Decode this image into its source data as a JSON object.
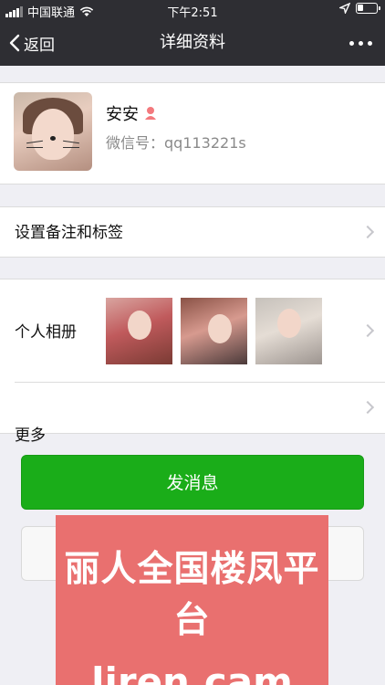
{
  "status_bar": {
    "carrier": "中国联通",
    "time": "下午2:51"
  },
  "nav": {
    "back_label": "返回",
    "title": "详细资料"
  },
  "profile": {
    "name": "安安",
    "wechat_id": "微信号：qq113221s",
    "gender_icon": "female-icon",
    "gender_color": "#f3797d"
  },
  "rows": {
    "remark_label": "设置备注和标签",
    "album_label": "个人相册",
    "more_label": "更多"
  },
  "buttons": {
    "send_message": "发消息",
    "send_color": "#1aad19"
  },
  "watermark": {
    "line1": "丽人全国楼凤平台",
    "line2": "liren.cam",
    "color": "#e9706f"
  }
}
